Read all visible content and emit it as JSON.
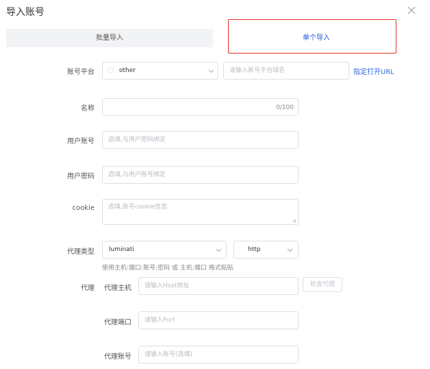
{
  "dialog": {
    "title": "导入账号"
  },
  "tabs": {
    "batch": "批量导入",
    "single": "单个导入"
  },
  "form": {
    "platform": {
      "label": "账号平台",
      "value": "other",
      "url_placeholder": "请输入账号平台域名",
      "url_link": "指定打开URL"
    },
    "name": {
      "label": "名称",
      "counter": "0/100"
    },
    "username": {
      "label": "用户账号",
      "placeholder": "选填,与用户密码绑定"
    },
    "password": {
      "label": "用户密码",
      "placeholder": "选填,与用户账号绑定"
    },
    "cookie": {
      "label": "cookie",
      "placeholder": "选填,账号cookie信息"
    },
    "proxy_type": {
      "label": "代理类型",
      "provider": "luminati",
      "protocol": "http",
      "hint": "使用主机:端口:账号:密码 或 主机:端口 格式粘贴"
    },
    "proxy": {
      "label": "代理",
      "host_label": "代理主机",
      "host_placeholder": "请输入Host地址",
      "check_button": "检查代理",
      "port_label": "代理端口",
      "port_placeholder": "请输入Port",
      "account_label": "代理账号",
      "account_placeholder": "请输入账号(选填)"
    }
  },
  "colors": {
    "accent": "#1e56d6",
    "highlight": "#e02a24",
    "link": "#2b6ce0"
  },
  "icons": {
    "close": "close-icon",
    "select_arrow": "chevron-down-icon",
    "resize": "resize-handle-icon"
  }
}
